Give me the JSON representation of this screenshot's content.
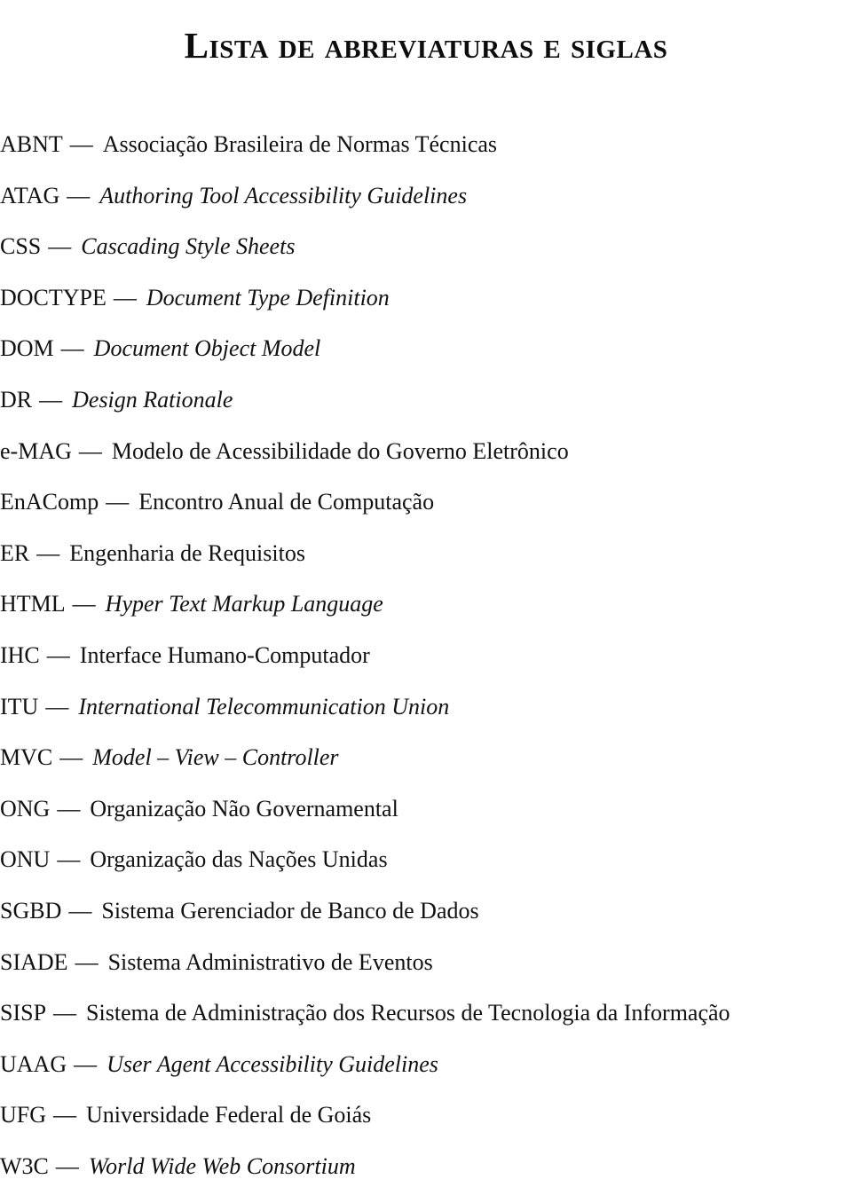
{
  "document": {
    "title": "Lista de abreviaturas e siglas",
    "separator": "—",
    "background_color": "#ffffff",
    "text_color": "#111111"
  },
  "entries": [
    {
      "term": "ABNT",
      "definition": "Associação Brasileira de Normas Técnicas",
      "italic": false
    },
    {
      "term": "ATAG",
      "definition": "Authoring Tool Accessibility Guidelines",
      "italic": true
    },
    {
      "term": "CSS",
      "definition": "Cascading Style Sheets",
      "italic": true
    },
    {
      "term": "DOCTYPE",
      "definition": "Document Type Definition",
      "italic": true
    },
    {
      "term": "DOM",
      "definition": "Document Object Model",
      "italic": true
    },
    {
      "term": "DR",
      "definition": "Design Rationale",
      "italic": true
    },
    {
      "term": "e-MAG",
      "definition": "Modelo de Acessibilidade do Governo Eletrônico",
      "italic": false
    },
    {
      "term": "EnAComp",
      "definition": "Encontro Anual de Computação",
      "italic": false
    },
    {
      "term": "ER",
      "definition": "Engenharia de Requisitos",
      "italic": false
    },
    {
      "term": "HTML",
      "definition": "Hyper Text Markup Language",
      "italic": true
    },
    {
      "term": "IHC",
      "definition": "Interface Humano-Computador",
      "italic": false
    },
    {
      "term": "ITU",
      "definition": "International Telecommunication Union",
      "italic": true
    },
    {
      "term": "MVC",
      "definition": "Model – View – Controller",
      "italic": true
    },
    {
      "term": "ONG",
      "definition": "Organização Não Governamental",
      "italic": false
    },
    {
      "term": "ONU",
      "definition": "Organização das Nações Unidas",
      "italic": false
    },
    {
      "term": "SGBD",
      "definition": "Sistema Gerenciador de Banco de Dados",
      "italic": false
    },
    {
      "term": "SIADE",
      "definition": "Sistema Administrativo de Eventos",
      "italic": false
    },
    {
      "term": "SISP",
      "definition": "Sistema de Administração dos Recursos de Tecnologia da Informação",
      "italic": false
    },
    {
      "term": "UAAG",
      "definition": "User Agent Accessibility Guidelines",
      "italic": true
    },
    {
      "term": "UFG",
      "definition": "Universidade Federal de Goiás",
      "italic": false
    },
    {
      "term": "W3C",
      "definition": "World Wide Web Consortium",
      "italic": true
    }
  ]
}
